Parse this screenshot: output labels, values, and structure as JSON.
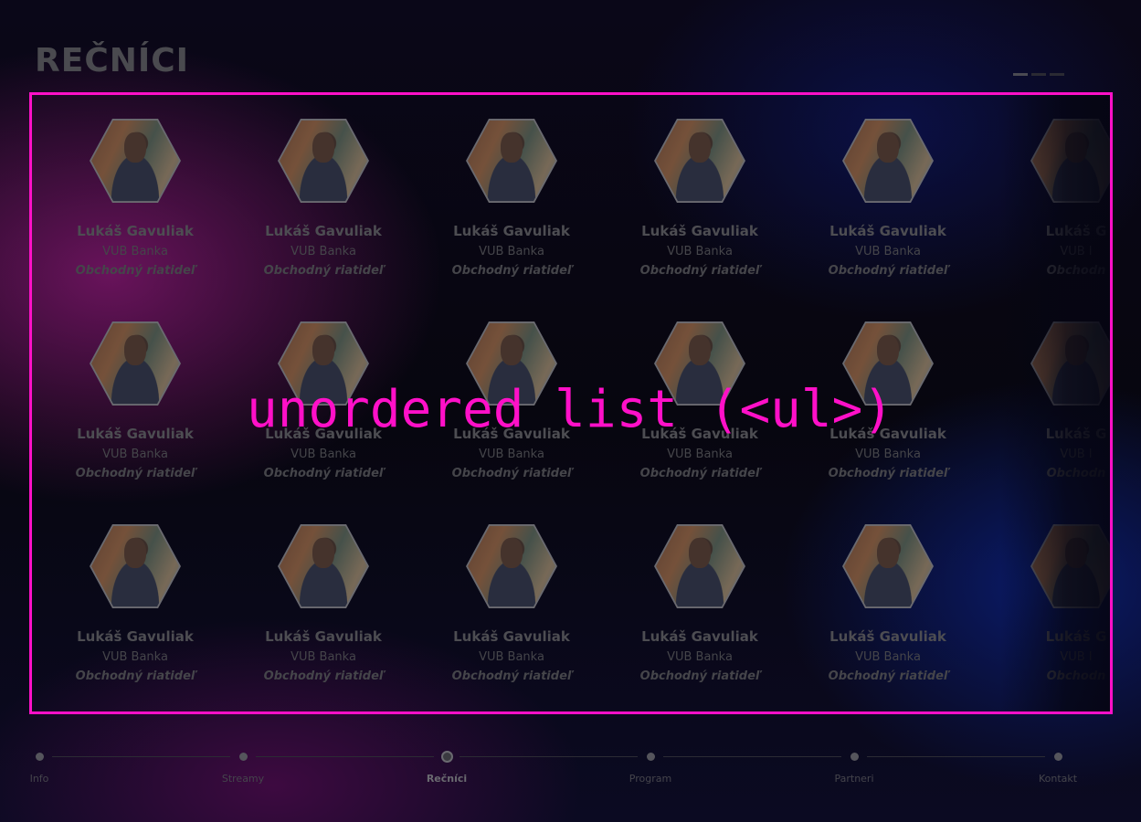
{
  "page": {
    "title": "REČNÍCI",
    "overlay_label": "unordered list (<ul>)"
  },
  "speaker": {
    "name": "Lukáš Gavuliak",
    "company": "VUB Banka",
    "role": "Obchodný riatideľ",
    "name_partial": "Lukáš G",
    "company_partial": "VUB I",
    "role_partial": "Obchodn"
  },
  "nav": {
    "items": [
      {
        "label": "Info",
        "active": false
      },
      {
        "label": "Streamy",
        "active": false
      },
      {
        "label": "Rečníci",
        "active": true
      },
      {
        "label": "Program",
        "active": false
      },
      {
        "label": "Partneri",
        "active": false
      },
      {
        "label": "Kontakt",
        "active": false
      }
    ]
  },
  "colors": {
    "highlight": "#ff10c8"
  }
}
